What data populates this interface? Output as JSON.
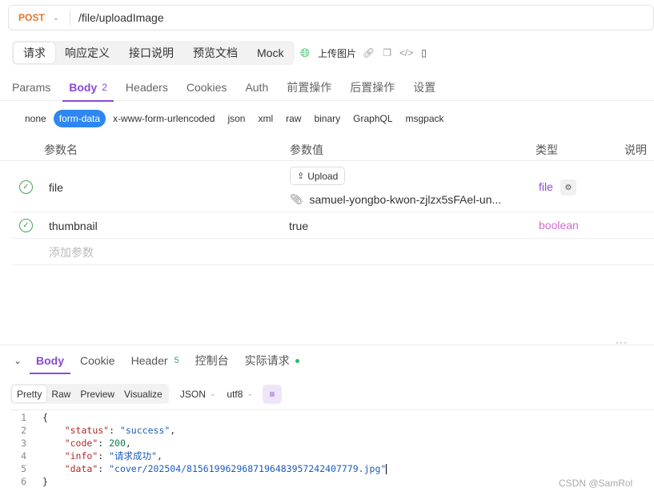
{
  "request": {
    "method": "POST",
    "url": "/file/uploadImage"
  },
  "top_tabs": [
    {
      "label": "请求",
      "active": true
    },
    {
      "label": "响应定义",
      "active": false
    },
    {
      "label": "接口说明",
      "active": false
    },
    {
      "label": "预览文档",
      "active": false
    },
    {
      "label": "Mock",
      "active": false
    }
  ],
  "toolbar": {
    "upload_label": "上传图片"
  },
  "req_tabs": [
    {
      "label": "Params",
      "active": false,
      "count": ""
    },
    {
      "label": "Body",
      "active": true,
      "count": "2"
    },
    {
      "label": "Headers",
      "active": false,
      "count": ""
    },
    {
      "label": "Cookies",
      "active": false,
      "count": ""
    },
    {
      "label": "Auth",
      "active": false,
      "count": ""
    },
    {
      "label": "前置操作",
      "active": false,
      "count": ""
    },
    {
      "label": "后置操作",
      "active": false,
      "count": ""
    },
    {
      "label": "设置",
      "active": false,
      "count": ""
    }
  ],
  "body_types": [
    {
      "label": "none",
      "active": false
    },
    {
      "label": "form-data",
      "active": true
    },
    {
      "label": "x-www-form-urlencoded",
      "active": false
    },
    {
      "label": "json",
      "active": false
    },
    {
      "label": "xml",
      "active": false
    },
    {
      "label": "raw",
      "active": false
    },
    {
      "label": "binary",
      "active": false
    },
    {
      "label": "GraphQL",
      "active": false
    },
    {
      "label": "msgpack",
      "active": false
    }
  ],
  "table": {
    "headers": {
      "name": "参数名",
      "value": "参数值",
      "type": "类型",
      "desc": "说明"
    },
    "rows": [
      {
        "name": "file",
        "upload_label": "Upload",
        "value": "samuel-yongbo-kwon-zjlzx5sFAel-un...",
        "type": "file",
        "type_color": "#8a4bd2"
      },
      {
        "name": "thumbnail",
        "value": "true",
        "type": "boolean",
        "type_color": "#d36bd0"
      }
    ],
    "add_placeholder": "添加参数"
  },
  "resp_tabs": [
    {
      "label": "Body",
      "active": true,
      "count": ""
    },
    {
      "label": "Cookie",
      "active": false,
      "count": ""
    },
    {
      "label": "Header",
      "active": false,
      "count": "5"
    },
    {
      "label": "控制台",
      "active": false,
      "count": ""
    },
    {
      "label": "实际请求",
      "active": false,
      "count": ""
    }
  ],
  "view_modes": [
    {
      "label": "Pretty",
      "active": true
    },
    {
      "label": "Raw",
      "active": false
    },
    {
      "label": "Preview",
      "active": false
    },
    {
      "label": "Visualize",
      "active": false
    }
  ],
  "format": "JSON",
  "encoding": "utf8",
  "code_lines": [
    {
      "num": "1",
      "parts": [
        [
          "p",
          "{"
        ]
      ]
    },
    {
      "num": "2",
      "parts": [
        [
          "p",
          "    "
        ],
        [
          "k",
          "\"status\""
        ],
        [
          "p",
          ": "
        ],
        [
          "s",
          "\"success\""
        ],
        [
          "p",
          ","
        ]
      ]
    },
    {
      "num": "3",
      "parts": [
        [
          "p",
          "    "
        ],
        [
          "k",
          "\"code\""
        ],
        [
          "p",
          ": "
        ],
        [
          "n",
          "200"
        ],
        [
          "p",
          ","
        ]
      ]
    },
    {
      "num": "4",
      "parts": [
        [
          "p",
          "    "
        ],
        [
          "k",
          "\"info\""
        ],
        [
          "p",
          ": "
        ],
        [
          "s",
          "\"请求成功\""
        ],
        [
          "p",
          ","
        ]
      ]
    },
    {
      "num": "5",
      "parts": [
        [
          "p",
          "    "
        ],
        [
          "k",
          "\"data\""
        ],
        [
          "p",
          ": "
        ],
        [
          "s",
          "\"cover/202504/8156199629687196483957242407779.jpg\""
        ]
      ]
    },
    {
      "num": "6",
      "parts": [
        [
          "p",
          "}"
        ]
      ]
    }
  ],
  "watermark": "CSDN @SamRol"
}
